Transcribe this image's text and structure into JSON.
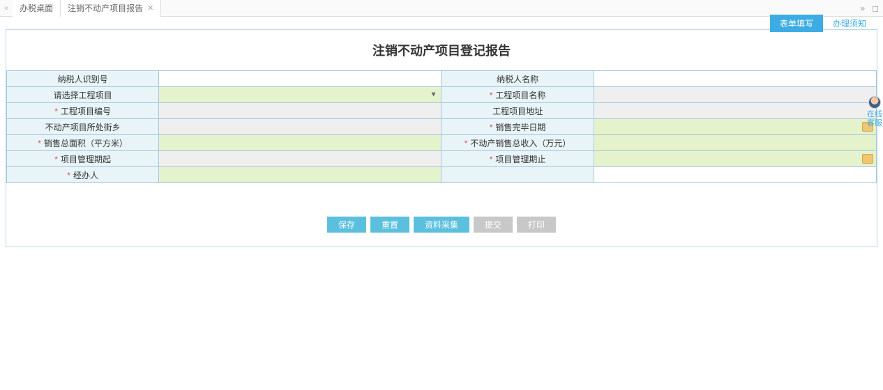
{
  "tabs": {
    "prev_icon": "tab-prev",
    "items": [
      {
        "label": "办税桌面",
        "closable": false
      },
      {
        "label": "注销不动产项目报告",
        "closable": true
      }
    ],
    "next_icon": "tab-next",
    "maximize_icon": "maximize"
  },
  "subtabs": {
    "fill": "表单填写",
    "notice": "办理须知"
  },
  "panel_title": "注销不动产项目登记报告",
  "form": {
    "taxpayer_id_label": "纳税人识别号",
    "taxpayer_id_value": "",
    "taxpayer_name_label": "纳税人名称",
    "taxpayer_name_value": "",
    "select_project_label": "请选择工程项目",
    "select_project_value": "",
    "project_name_label": "工程项目名称",
    "project_name_value": "",
    "project_code_label": "工程项目编号",
    "project_code_value": "",
    "project_addr_label": "工程项目地址",
    "project_addr_value": "",
    "street_label": "不动产项目所处街乡",
    "street_value": "",
    "sale_complete_date_label": "销售完毕日期",
    "sale_complete_date_value": "",
    "sale_area_label": "销售总面积（平方米）",
    "sale_area_value": "",
    "sale_income_label": "不动产销售总收入（万元）",
    "sale_income_value": "",
    "mgmt_start_label": "项目管理期起",
    "mgmt_start_value": "",
    "mgmt_end_label": "项目管理期止",
    "mgmt_end_value": "",
    "operator_label": "经办人",
    "operator_value": ""
  },
  "buttons": {
    "save": "保存",
    "reset": "重置",
    "collect": "资料采集",
    "submit": "提交",
    "print": "打印"
  },
  "side": {
    "label": "在线客服"
  }
}
